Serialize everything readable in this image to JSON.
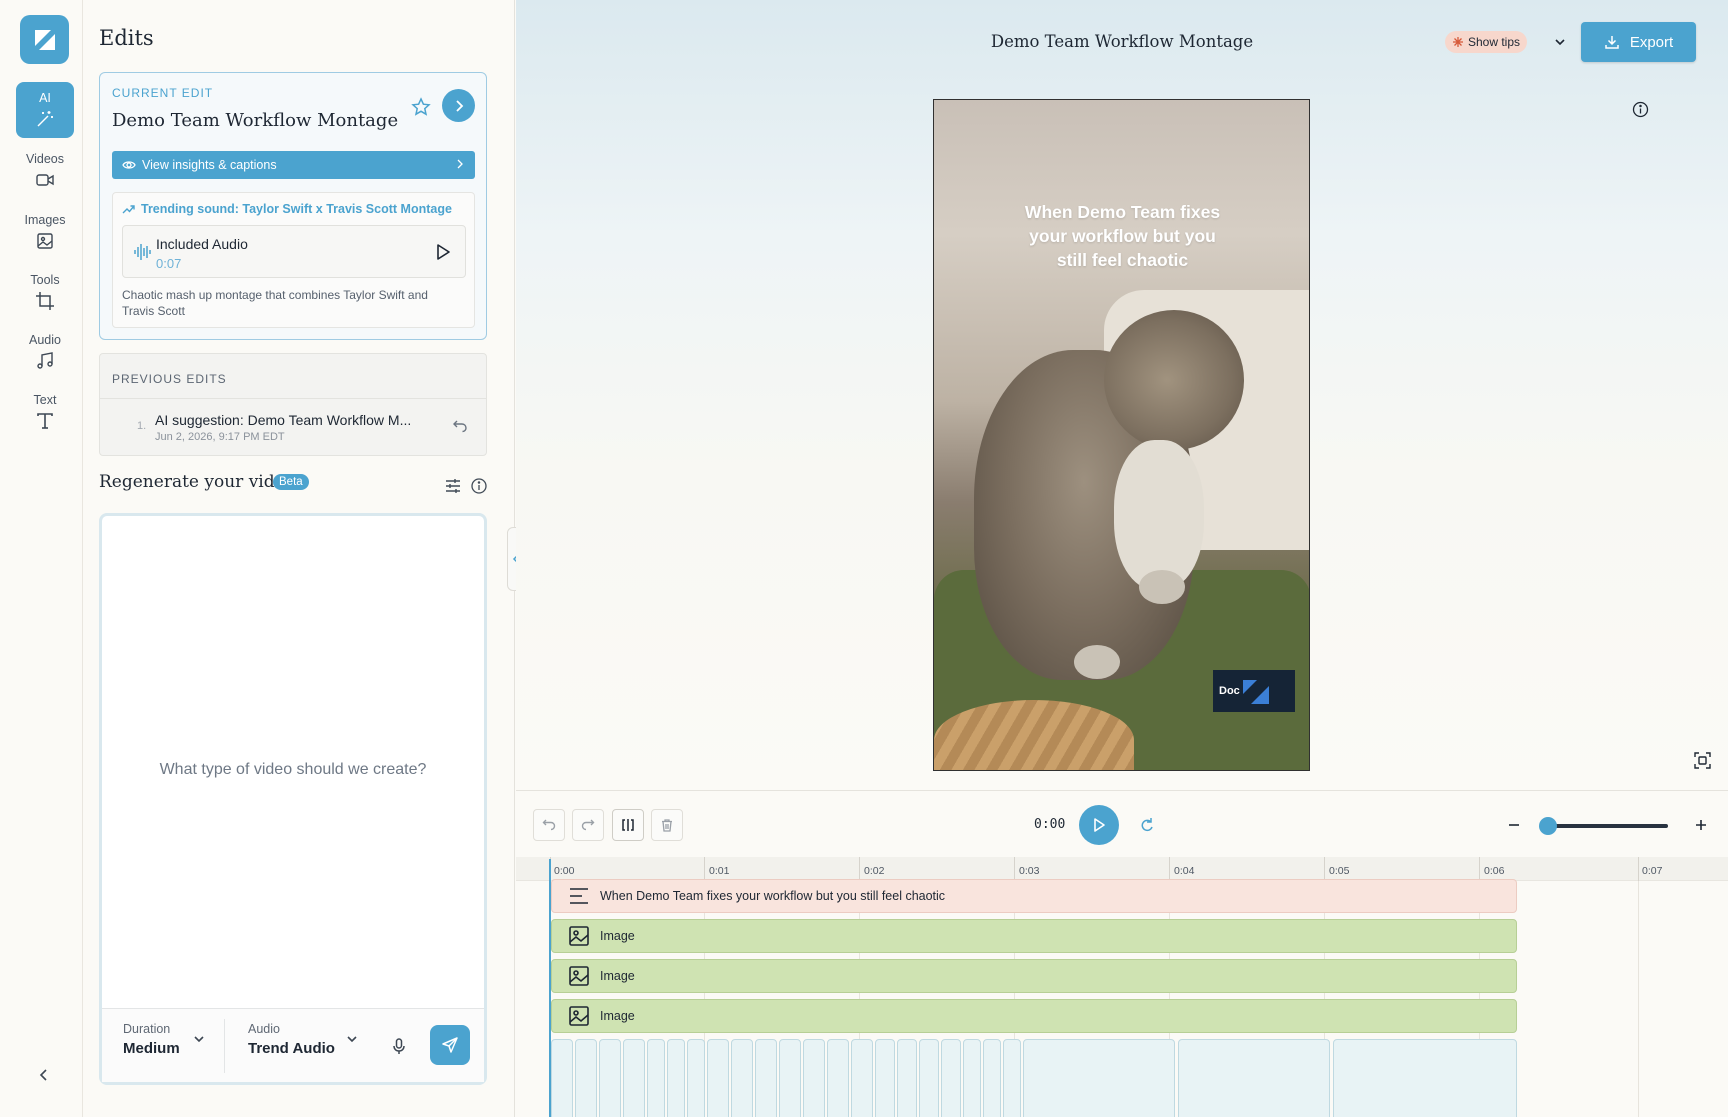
{
  "rail": {
    "items": [
      {
        "label": "AI",
        "icon": "magic-wand-icon"
      },
      {
        "label": "Videos",
        "icon": "video-icon"
      },
      {
        "label": "Images",
        "icon": "image-icon"
      },
      {
        "label": "Tools",
        "icon": "crop-icon"
      },
      {
        "label": "Audio",
        "icon": "music-icon"
      },
      {
        "label": "Text",
        "icon": "text-icon"
      }
    ]
  },
  "edits": {
    "title": "Edits",
    "current": {
      "kicker": "CURRENT EDIT",
      "title": "Demo Team Workflow Montage",
      "insights_label": "View insights & captions",
      "trending_label": "Trending sound: Taylor Swift x Travis Scott Montage",
      "audio_title": "Included Audio",
      "audio_time": "0:07",
      "description": "Chaotic mash up montage that combines Taylor Swift and Travis Scott"
    },
    "previous": {
      "kicker": "PREVIOUS EDITS",
      "items": [
        {
          "num": "1.",
          "title": "AI suggestion: Demo Team Workflow M...",
          "date": "Jun 2, 2026, 9:17 PM EDT"
        }
      ]
    }
  },
  "regen": {
    "title": "Regenerate your video",
    "badge": "Beta",
    "placeholder": "What type of video should we create?",
    "duration_label": "Duration",
    "duration_value": "Medium",
    "audio_label": "Audio",
    "audio_value": "Trend Audio"
  },
  "header": {
    "title": "Demo Team Workflow Montage",
    "tips_label": "Show tips",
    "export_label": "Export"
  },
  "video": {
    "caption": "When Demo Team fixes your workflow but you still feel chaotic",
    "watermark": "Doc"
  },
  "timeline": {
    "time": "0:00",
    "ticks": [
      "0:00",
      "0:01",
      "0:02",
      "0:03",
      "0:04",
      "0:05",
      "0:06",
      "0:07"
    ],
    "tracks": [
      {
        "type": "text",
        "label": "When Demo Team fixes your workflow but you still feel chaotic"
      },
      {
        "type": "image",
        "label": "Image"
      },
      {
        "type": "image",
        "label": "Image"
      },
      {
        "type": "image",
        "label": "Image"
      }
    ]
  },
  "colors": {
    "accent": "#4ba3cf",
    "text_track": "#f9e4dd",
    "image_track": "#cfe3b2",
    "tips_badge": "#f7d7cc"
  }
}
